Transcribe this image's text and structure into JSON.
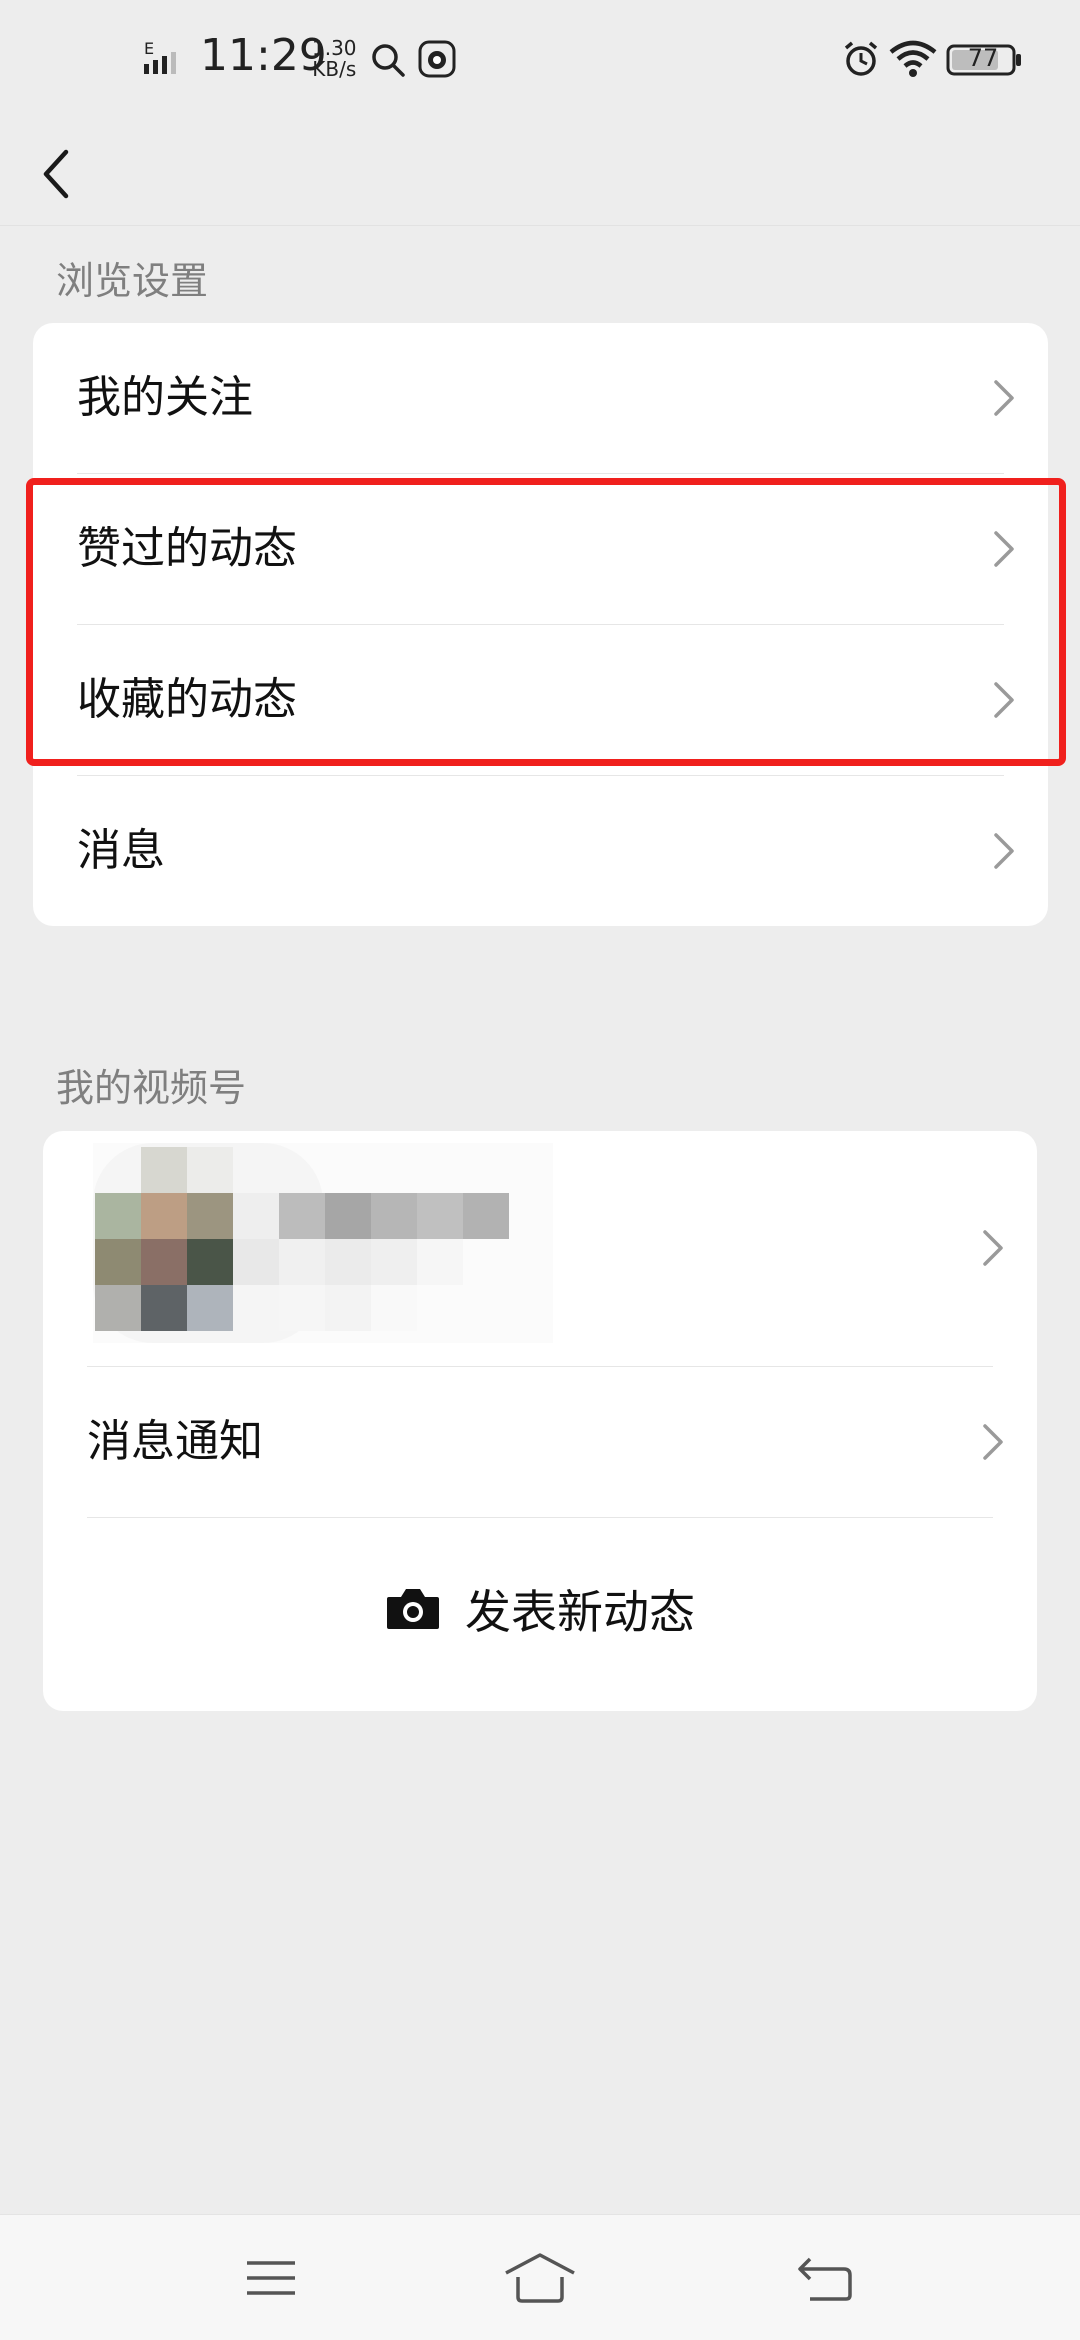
{
  "status_bar": {
    "network_type": "E",
    "time": "11:29",
    "speed_value": "1.30",
    "speed_unit": "KB/s",
    "battery": "77"
  },
  "icons": {
    "back": "back-arrow-icon",
    "chevron": "chevron-right-icon",
    "camera": "camera-icon",
    "menu": "menu-icon",
    "home": "home-icon",
    "return": "return-icon"
  },
  "browse_section": {
    "title": "浏览设置",
    "items": [
      {
        "label": "我的关注"
      },
      {
        "label": "赞过的动态"
      },
      {
        "label": "收藏的动态"
      },
      {
        "label": "消息"
      }
    ]
  },
  "channel_section": {
    "title": "我的视频号",
    "notifications_label": "消息通知",
    "post_label": "发表新动态"
  },
  "colors": {
    "background": "#ededed",
    "card": "#ffffff",
    "highlight": "#f0201d",
    "secondary_text": "#7f7f7f"
  }
}
